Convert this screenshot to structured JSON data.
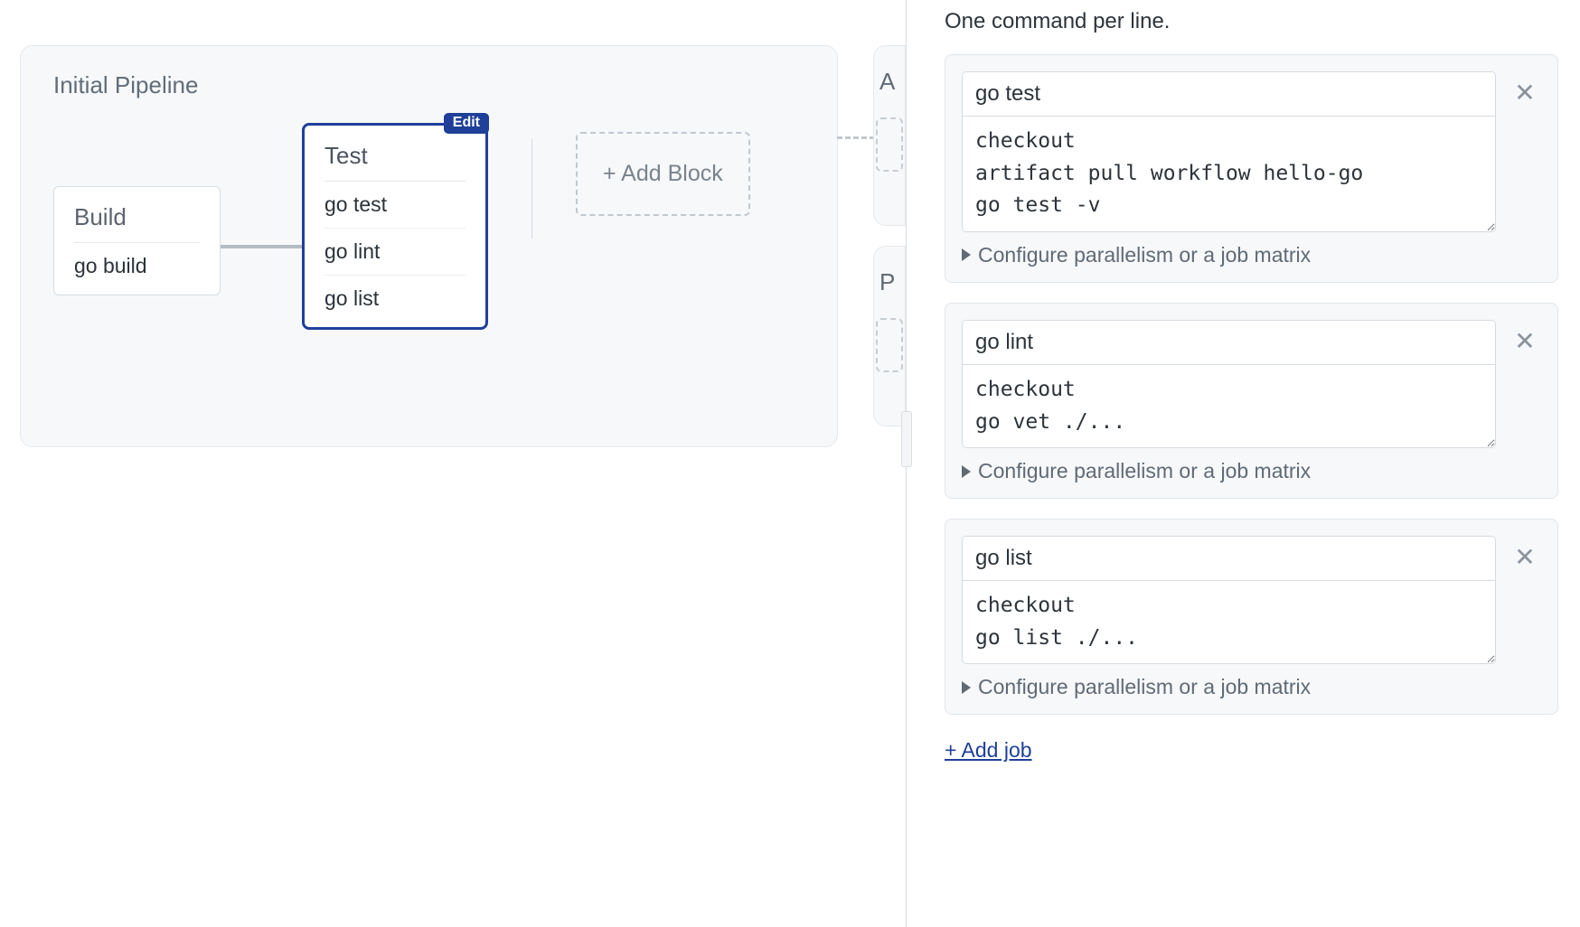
{
  "pipeline": {
    "title": "Initial Pipeline",
    "blocks": {
      "build": {
        "title": "Build",
        "jobs": [
          "go build"
        ]
      },
      "test": {
        "title": "Test",
        "edit_label": "Edit",
        "jobs": [
          "go test",
          "go lint",
          "go list"
        ]
      }
    },
    "add_block_label": "+ Add Block"
  },
  "peek": {
    "a_letter": "A",
    "p_letter": "P"
  },
  "panel": {
    "hint": "One command per line.",
    "parallelism_label": "Configure parallelism or a job matrix",
    "add_job_label": "+ Add job",
    "jobs": [
      {
        "name": "go test",
        "commands": "checkout\nartifact pull workflow hello-go\ngo test -v"
      },
      {
        "name": "go lint",
        "commands": "checkout\ngo vet ./..."
      },
      {
        "name": "go list",
        "commands": "checkout\ngo list ./..."
      }
    ]
  }
}
